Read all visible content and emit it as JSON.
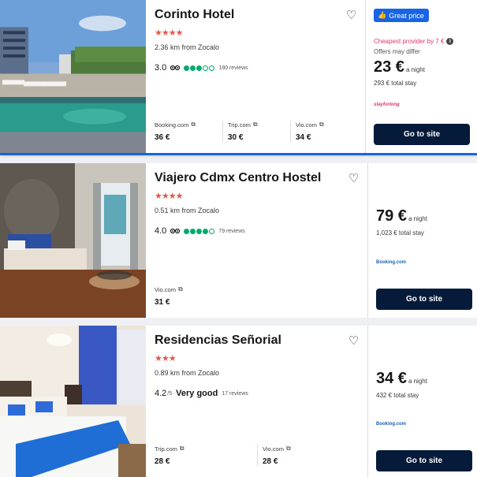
{
  "hotels": [
    {
      "name": "Corinto Hotel",
      "stars": "★★★★",
      "distance": "2.36 km from Zocalo",
      "score": "3.0",
      "score_out": "",
      "rating_label": "",
      "rating_dots": 3,
      "reviews": "180 reviews",
      "badge": "Great price",
      "cheapest": "Cheapest provider by 7 €",
      "offers_differ": "Offers may differ",
      "price": "23 €",
      "per_night": "a night",
      "total": "293 € total stay",
      "provider_logo": "stayforlong",
      "provider_logo_color": "#e0366f",
      "cta": "Go to site",
      "providers": [
        {
          "name": "Booking.com",
          "price": "36 €"
        },
        {
          "name": "Trip.com",
          "price": "30 €"
        },
        {
          "name": "Vio.com",
          "price": "34 €"
        }
      ]
    },
    {
      "name": "Viajero Cdmx Centro Hostel",
      "stars": "★★★★",
      "distance": "0.51 km from Zocalo",
      "score": "4.0",
      "rating_dots": 4,
      "reviews": "79 reviews",
      "price": "79 €",
      "per_night": "a night",
      "total": "1,023 € total stay",
      "provider_logo": "Booking.com",
      "provider_logo_color": "#1a5fb4",
      "cta": "Go to site",
      "providers": [
        {
          "name": "Vio.com",
          "price": "31 €"
        }
      ]
    },
    {
      "name": "Residencias Señorial",
      "stars": "★★★",
      "distance": "0.89 km from Zocalo",
      "score": "4.2",
      "score_out": "/5",
      "rating_label": "Very good",
      "reviews": "17 reviews",
      "price": "34 €",
      "per_night": "a night",
      "total": "432 € total stay",
      "provider_logo": "Booking.com",
      "provider_logo_color": "#1a5fb4",
      "cta": "Go to site",
      "providers": [
        {
          "name": "Trip.com",
          "price": "28 €"
        },
        {
          "name": "Vio.com",
          "price": "28 €"
        }
      ]
    }
  ],
  "icons": {
    "favorite": "heart-icon",
    "external": "external-link-icon",
    "thumb": "thumbs-up-icon",
    "info": "info-icon",
    "tripadvisor": "tripadvisor-owl-icon"
  },
  "colors": {
    "badge": "#1765e4",
    "cta": "#061a3a",
    "stars": "#e4584a",
    "cheapest": "#e0366f",
    "tripadvisor": "#00aa6c"
  }
}
